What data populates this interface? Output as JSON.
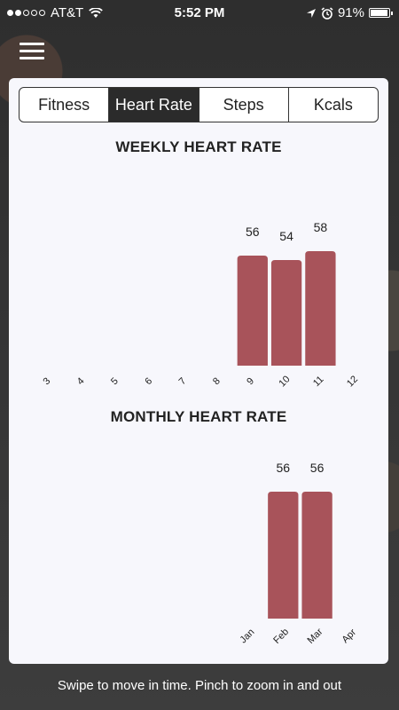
{
  "status_bar": {
    "carrier": "AT&T",
    "time": "5:52 PM",
    "battery": "91%"
  },
  "tabs": [
    {
      "label": "Fitness",
      "active": false
    },
    {
      "label": "Heart Rate",
      "active": true
    },
    {
      "label": "Steps",
      "active": false
    },
    {
      "label": "Kcals",
      "active": false
    }
  ],
  "bar_color": "#a8535a",
  "chart_data": [
    {
      "type": "bar",
      "title": "WEEKLY HEART RATE",
      "categories": [
        "3",
        "4",
        "5",
        "6",
        "7",
        "8",
        "9",
        "10",
        "11",
        "12"
      ],
      "values": [
        null,
        null,
        null,
        null,
        null,
        null,
        56,
        54,
        58,
        null
      ],
      "data_labels": [
        "",
        "",
        "",
        "",
        "",
        "",
        "56",
        "54",
        "58",
        ""
      ]
    },
    {
      "type": "bar",
      "title": "MONTHLY HEART RATE",
      "categories": [
        "Jan",
        "Feb",
        "Mar",
        "Apr"
      ],
      "values": [
        null,
        56,
        56,
        null
      ],
      "data_labels": [
        "",
        "56",
        "56",
        ""
      ]
    }
  ],
  "footer_hint": "Swipe to move in time. Pinch to zoom in and out"
}
